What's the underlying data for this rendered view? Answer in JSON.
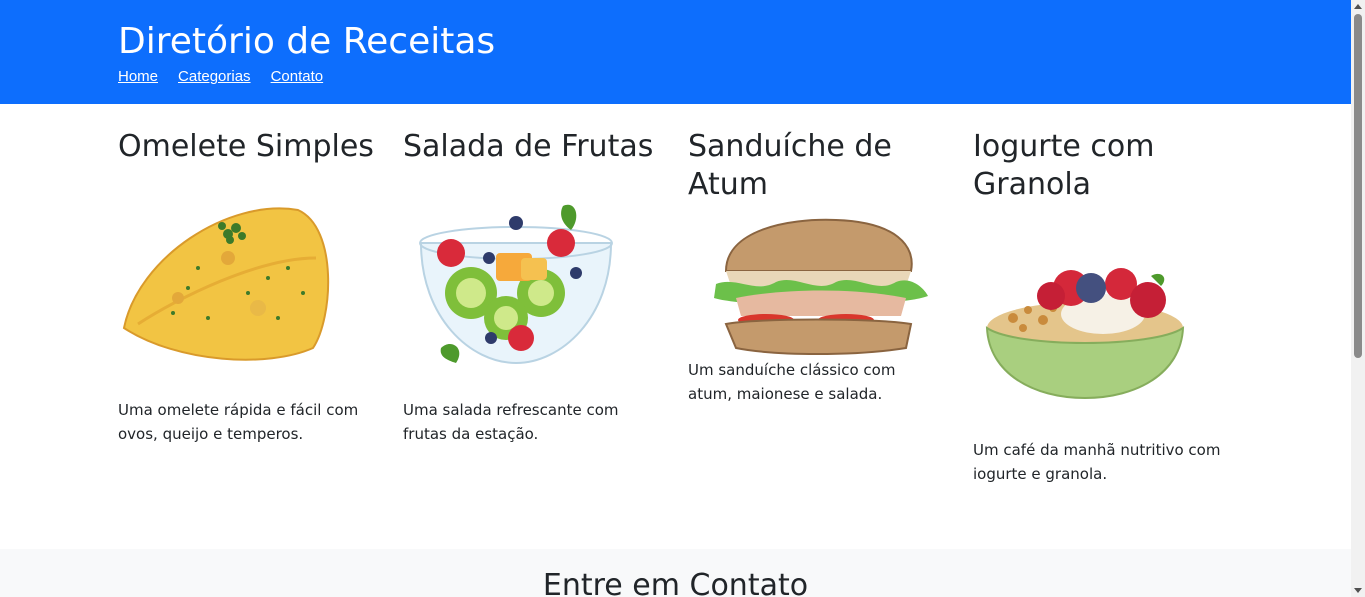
{
  "header": {
    "title": "Diretório de Receitas",
    "nav": [
      "Home",
      "Categorias",
      "Contato"
    ],
    "background_color": "#0d6efd"
  },
  "recipes": [
    {
      "title": "Omelete Simples",
      "description": "Uma omelete rápida e fácil com ovos, queijo e temperos.",
      "image": "omelette-image"
    },
    {
      "title": "Salada de Frutas",
      "description": "Uma salada refrescante com frutas da estação.",
      "image": "fruit-salad-image"
    },
    {
      "title": "Sanduíche de Atum",
      "description": "Um sanduíche clássico com atum, maionese e salada.",
      "image": "tuna-sandwich-image"
    },
    {
      "title": "Iogurte com Granola",
      "description": "Um café da manhã nutritivo com iogurte e granola.",
      "image": "yogurt-granola-image"
    }
  ],
  "contact": {
    "title": "Entre em Contato"
  }
}
